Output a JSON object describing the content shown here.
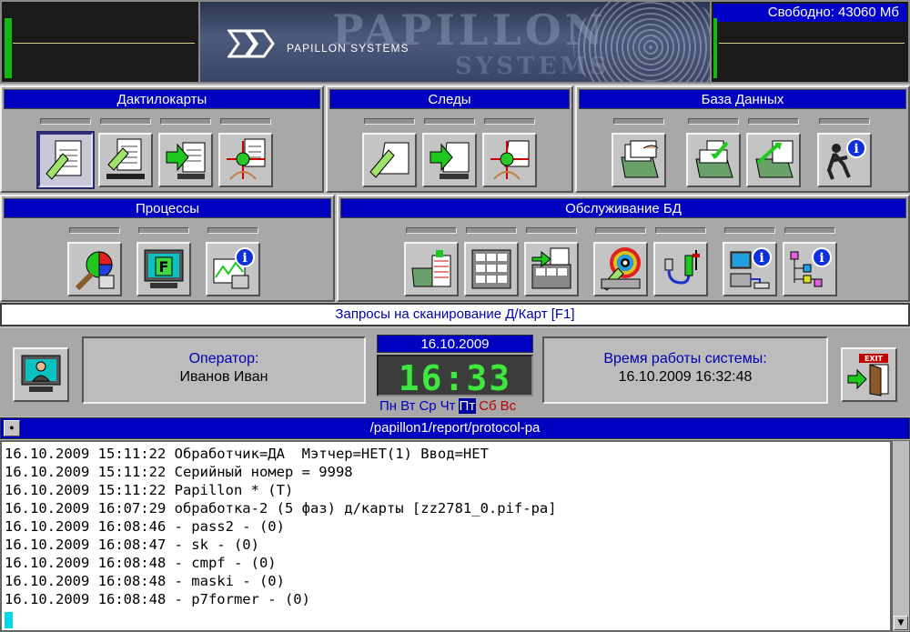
{
  "header": {
    "free_space": "Свободно: 43060 Мб",
    "logo_text": "PAPILLON   SYSTEMS",
    "watermark_top": "PAPILLON",
    "watermark_bottom": "SYSTEMS"
  },
  "panels": {
    "fingerprint_cards": {
      "title": "Дактилокарты",
      "tools": [
        "card-edit-icon",
        "card-scan-icon",
        "card-input-icon",
        "card-match-icon"
      ]
    },
    "traces": {
      "title": "Следы",
      "tools": [
        "trace-edit-icon",
        "trace-input-icon",
        "trace-match-icon"
      ]
    },
    "database": {
      "title": "База Данных",
      "tools": [
        "db-card-index-icon",
        "db-load-icon",
        "db-export-icon",
        "db-info-icon"
      ]
    },
    "processes": {
      "title": "Процессы",
      "tools": [
        "process-chart-icon",
        "process-f-monitor-icon",
        "process-graph-info-icon"
      ]
    },
    "db_service": {
      "title": "Обслуживание БД",
      "tools": [
        "db-service-tables-icon",
        "db-service-grid-icon",
        "db-service-copy-icon",
        "db-service-disk-icon",
        "db-service-cable-icon",
        "db-service-network-info-icon",
        "db-service-tree-info-icon"
      ]
    }
  },
  "command_line": "Запросы на сканирование Д/Карт [F1]",
  "operator": {
    "label": "Оператор:",
    "name": "Иванов Иван"
  },
  "clock": {
    "date": "16.10.2009",
    "time": "16:33",
    "weekdays": [
      "Пн",
      "Вт",
      "Ср",
      "Чт",
      "Пт",
      "Сб",
      "Вс"
    ],
    "today_index": 4
  },
  "uptime": {
    "label": "Время работы системы:",
    "value": "16.10.2009 16:32:48"
  },
  "exit_label": "EXIT",
  "log": {
    "title": "/papillon1/report/protocol-pa",
    "lines": [
      "16.10.2009 15:11:22 Обработчик=ДА  Мэтчер=НЕТ(1) Ввод=НЕТ",
      "16.10.2009 15:11:22 Серийный номер = 9998",
      "16.10.2009 15:11:22 Papillon * (T)",
      "16.10.2009 16:07:29 обработка-2 (5 фаз) д/карты [zz2781_0.pif-pa]",
      "16.10.2009 16:08:46 - pass2 - (0)",
      "16.10.2009 16:08:47 - sk - (0)",
      "16.10.2009 16:08:48 - cmpf - (0)",
      "16.10.2009 16:08:48 - maski - (0)",
      "16.10.2009 16:08:48 - p7former - (0)"
    ]
  },
  "colors": {
    "title_bar": "#0000c0",
    "clock_digits": "#3ee83e",
    "gauge": "#14b814"
  }
}
